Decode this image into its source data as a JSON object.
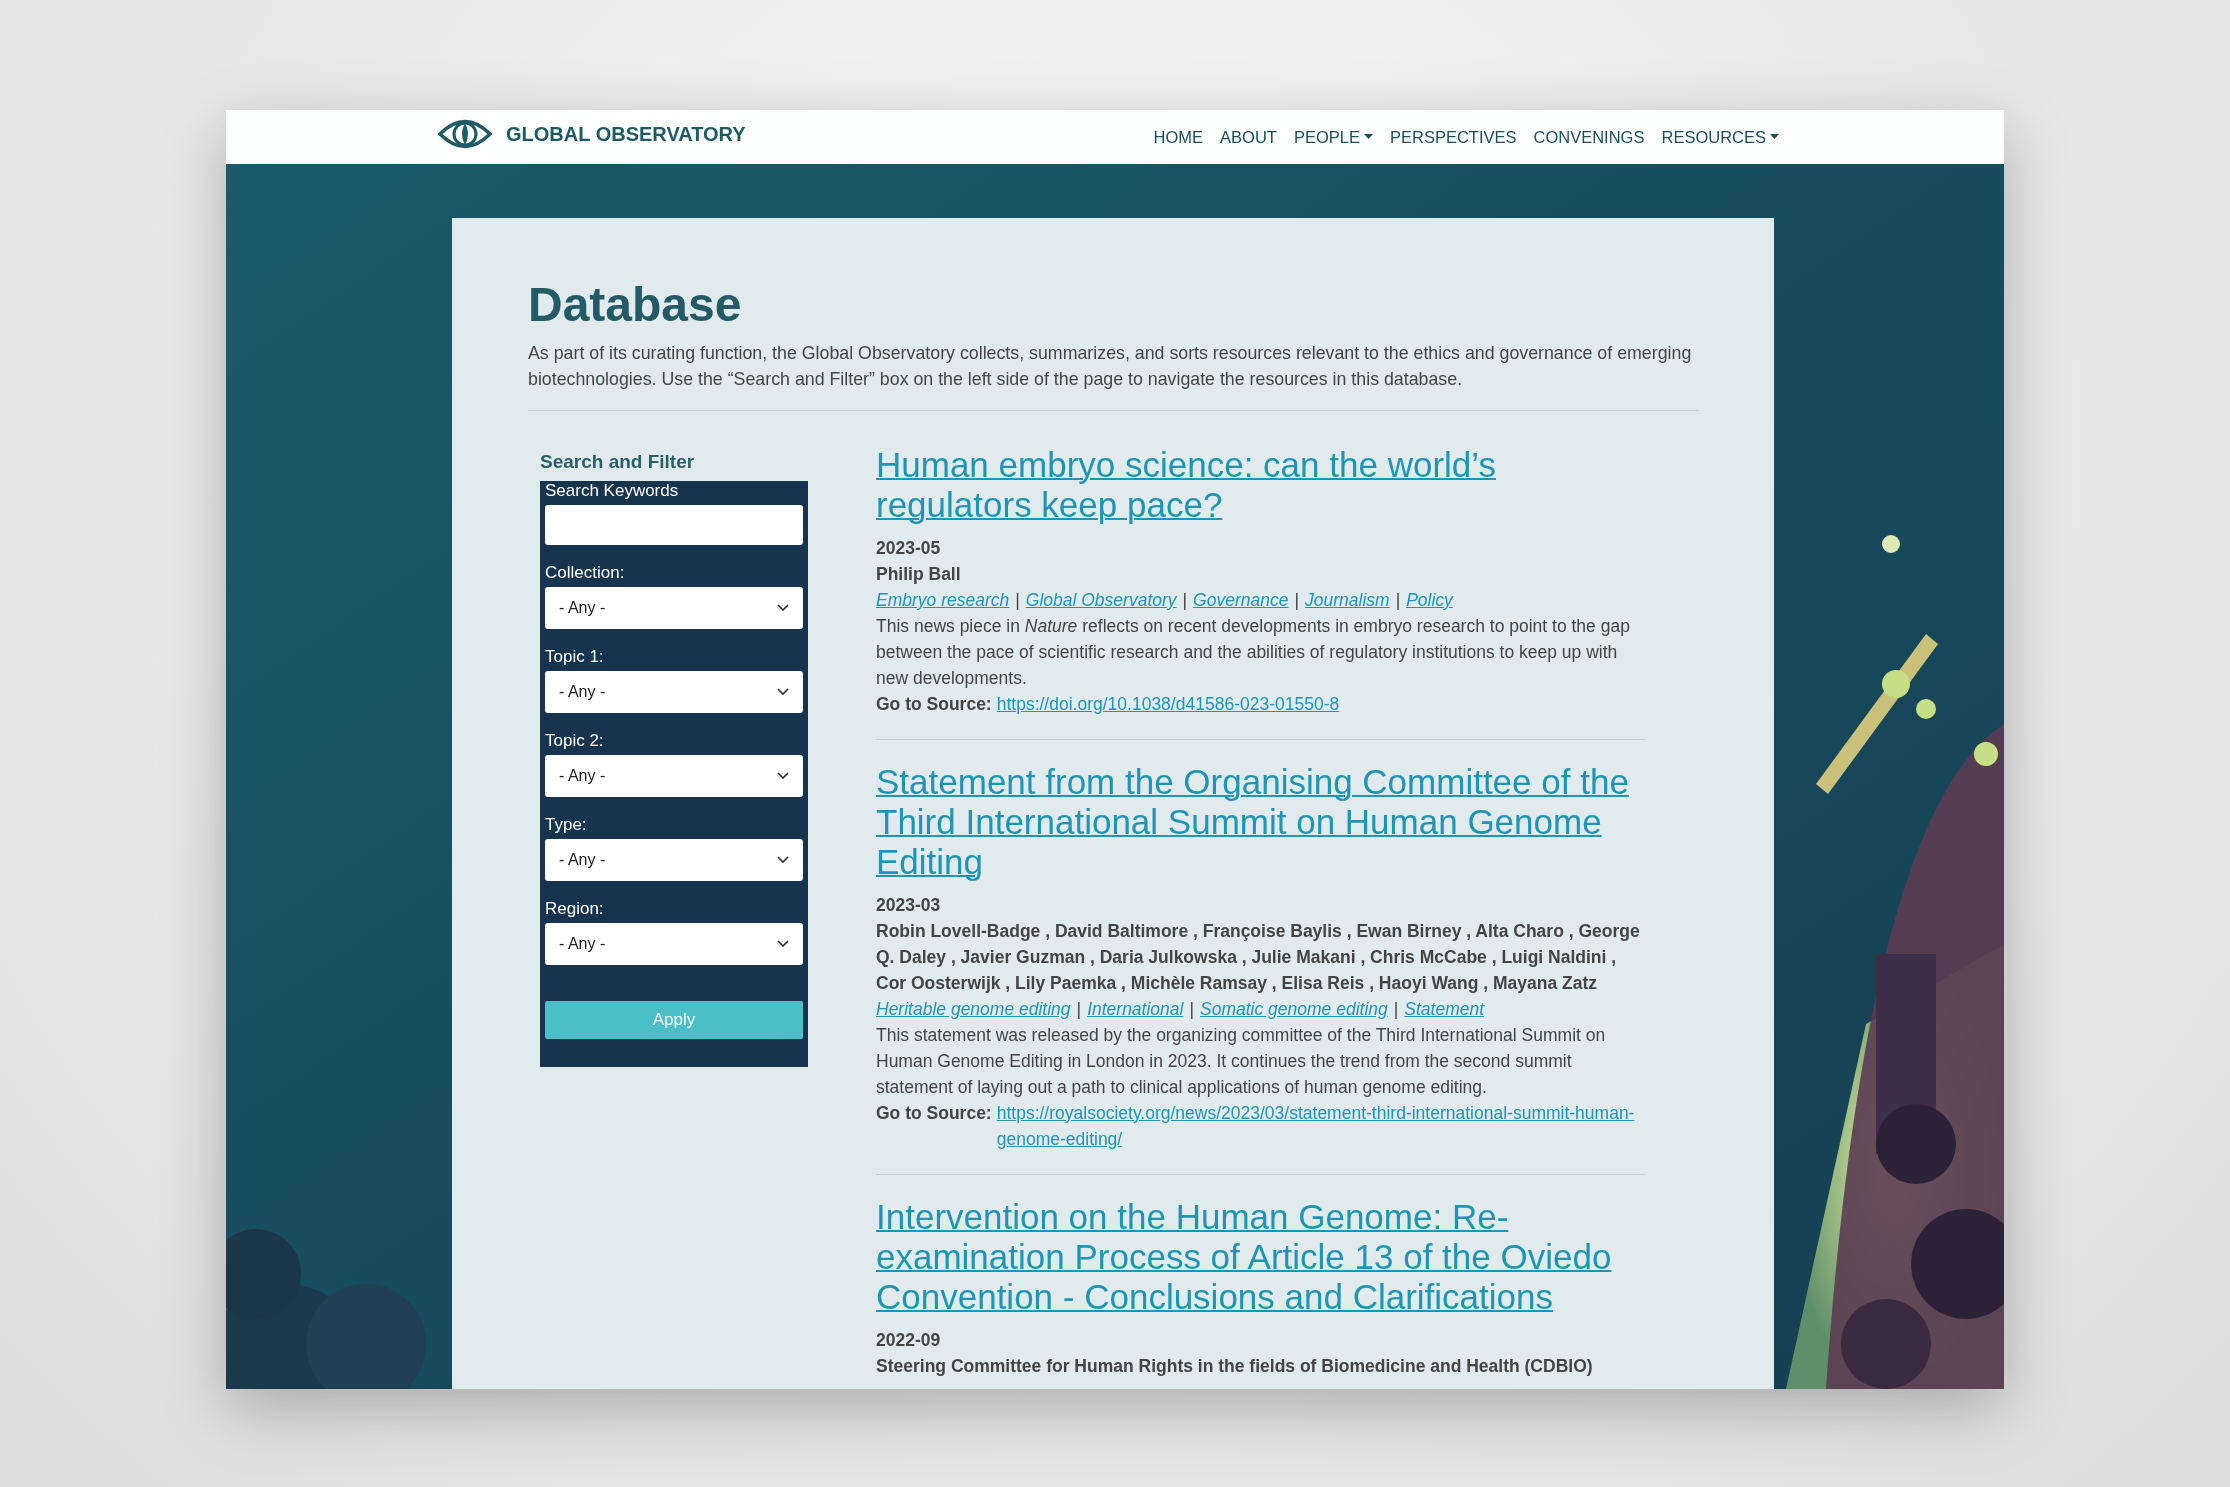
{
  "header": {
    "brand": "GLOBAL OBSERVATORY",
    "nav": [
      {
        "label": "HOME",
        "dropdown": false
      },
      {
        "label": "ABOUT",
        "dropdown": false
      },
      {
        "label": "PEOPLE",
        "dropdown": true
      },
      {
        "label": "PERSPECTIVES",
        "dropdown": false
      },
      {
        "label": "CONVENINGS",
        "dropdown": false
      },
      {
        "label": "RESOURCES",
        "dropdown": true
      }
    ]
  },
  "page": {
    "title": "Database",
    "intro": "As part of its curating function, the Global Observatory collects, summarizes, and sorts resources relevant to the ethics and governance of emerging biotechnologies. Use the “Search and Filter” box on the left side of the page to navigate the resources in this database."
  },
  "filter": {
    "title": "Search and Filter",
    "search_label": "Search Keywords",
    "selects": [
      {
        "label": "Collection:",
        "value": "- Any -"
      },
      {
        "label": "Topic 1:",
        "value": "- Any -"
      },
      {
        "label": "Topic 2:",
        "value": "- Any -"
      },
      {
        "label": "Type:",
        "value": "- Any -"
      },
      {
        "label": "Region:",
        "value": "- Any -"
      }
    ],
    "button": "Apply"
  },
  "tag_separator": "|",
  "articles": [
    {
      "title": "Human embryo science: can the world’s regulators keep pace?",
      "date": "2023-05",
      "authors": "Philip Ball",
      "tags": [
        "Embryo research",
        "Global Observatory",
        "Governance",
        "Journalism",
        "Policy"
      ],
      "summary": "This news piece in *Nature* reflects on recent developments in embryo research to point to the gap between the pace of scientific research and the abilities of regulatory institutions to keep up with new developments.",
      "source_label": "Go to Source:",
      "source_url": "https://doi.org/10.1038/d41586-023-01550-8"
    },
    {
      "title": "Statement from the Organising Committee of the Third International Summit on Human Genome Editing",
      "date": "2023-03",
      "authors": "Robin Lovell-Badge , David Baltimore , Françoise Baylis , Ewan Birney , Alta Charo , George Q. Daley , Javier Guzman , Daria Julkowska , Julie Makani , Chris McCabe , Luigi Naldini , Cor Oosterwijk , Lily Paemka , Michèle Ramsay , Elisa Reis , Haoyi Wang , Mayana Zatz",
      "tags": [
        "Heritable genome editing",
        "International",
        "Somatic genome editing",
        "Statement"
      ],
      "summary": "This statement was released by the organizing committee of the Third International Summit on Human Genome Editing in London in 2023. It continues the trend from the second summit statement of laying out a path to clinical applications of human genome editing.",
      "source_label": "Go to Source:",
      "source_url": "https://royalsociety.org/news/2023/03/statement-third-international-summit-human-genome-editing/"
    },
    {
      "title": "Intervention on the Human Genome: Re-examination Process of Article 13 of the Oviedo Convention - Conclusions and Clarifications",
      "date": "2022-09",
      "authors": "Steering Committee for Human Rights in the fields of Biomedicine and Health (CDBIO)"
    }
  ]
}
